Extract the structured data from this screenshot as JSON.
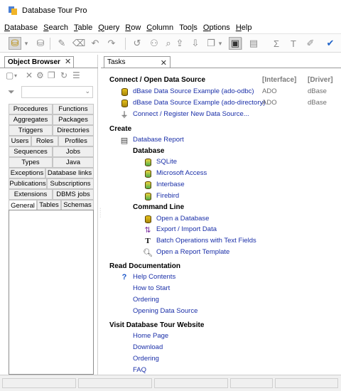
{
  "window": {
    "title": "Database Tour Pro"
  },
  "menu": [
    {
      "pre": "",
      "u": "D",
      "post": "atabase"
    },
    {
      "pre": "",
      "u": "S",
      "post": "earch"
    },
    {
      "pre": "",
      "u": "T",
      "post": "able"
    },
    {
      "pre": "",
      "u": "Q",
      "post": "uery"
    },
    {
      "pre": "",
      "u": "R",
      "post": "ow"
    },
    {
      "pre": "",
      "u": "C",
      "post": "olumn"
    },
    {
      "pre": "Too",
      "u": "l",
      "post": "s"
    },
    {
      "pre": "",
      "u": "O",
      "post": "ptions"
    },
    {
      "pre": "",
      "u": "H",
      "post": "elp"
    }
  ],
  "toolbar": {
    "icons": [
      "open-database-icon",
      "dropdown-arrow-icon",
      "close-database-icon",
      "edit-icon",
      "clear-icon",
      "undo-icon",
      "redo-icon",
      "cancel-icon",
      "binoculars-icon",
      "find-next-icon",
      "export-icon",
      "import-icon",
      "copy-icon",
      "dropdown-arrow-icon",
      "record-view-icon",
      "report-icon",
      "sum-icon",
      "text-icon",
      "edit-text-icon",
      "checkmark-icon"
    ]
  },
  "object_browser": {
    "title": "Object Browser",
    "close": "✕",
    "tabs_rows": [
      [
        "Procedures",
        "Functions"
      ],
      [
        "Aggregates",
        "Packages"
      ],
      [
        "Triggers",
        "Directories"
      ],
      [
        "Users",
        "Roles",
        "Profiles"
      ],
      [
        "Sequences",
        "Jobs"
      ],
      [
        "Types",
        "Java"
      ],
      [
        "Exceptions",
        "Database links"
      ],
      [
        "Publications",
        "Subscriptions"
      ],
      [
        "Extensions",
        "DBMS jobs"
      ],
      [
        "General",
        "Tables",
        "Schemas"
      ]
    ],
    "selected_tab": "General"
  },
  "tasks": {
    "tab_label": "Tasks",
    "close": "✕",
    "connect": {
      "title": "Connect / Open Data Source",
      "col_interface": "[Interface]",
      "col_driver": "[Driver]",
      "sources": [
        {
          "label": "dBase Data Source Example (ado-odbc)",
          "interface": "ADO",
          "driver": "dBase"
        },
        {
          "label": "dBase Data Source Example (ado-directory)",
          "interface": "ADO",
          "driver": "dBase"
        }
      ],
      "register": "Connect / Register New Data Source..."
    },
    "create": {
      "title": "Create",
      "report": "Database Report",
      "database_title": "Database",
      "databases": [
        "SQLite",
        "Microsoft Access",
        "Interbase",
        "Firebird"
      ],
      "cmdline_title": "Command Line",
      "cmdline": [
        "Open a Database",
        "Export / Import Data",
        "Batch Operations with Text Fields",
        "Open a Report Template"
      ]
    },
    "docs": {
      "title": "Read Documentation",
      "items": [
        "Help Contents",
        "How to Start",
        "Ordering",
        "Opening Data Source"
      ]
    },
    "website": {
      "title": "Visit Database Tour Website",
      "items": [
        "Home Page",
        "Download",
        "Ordering",
        "FAQ"
      ]
    }
  }
}
